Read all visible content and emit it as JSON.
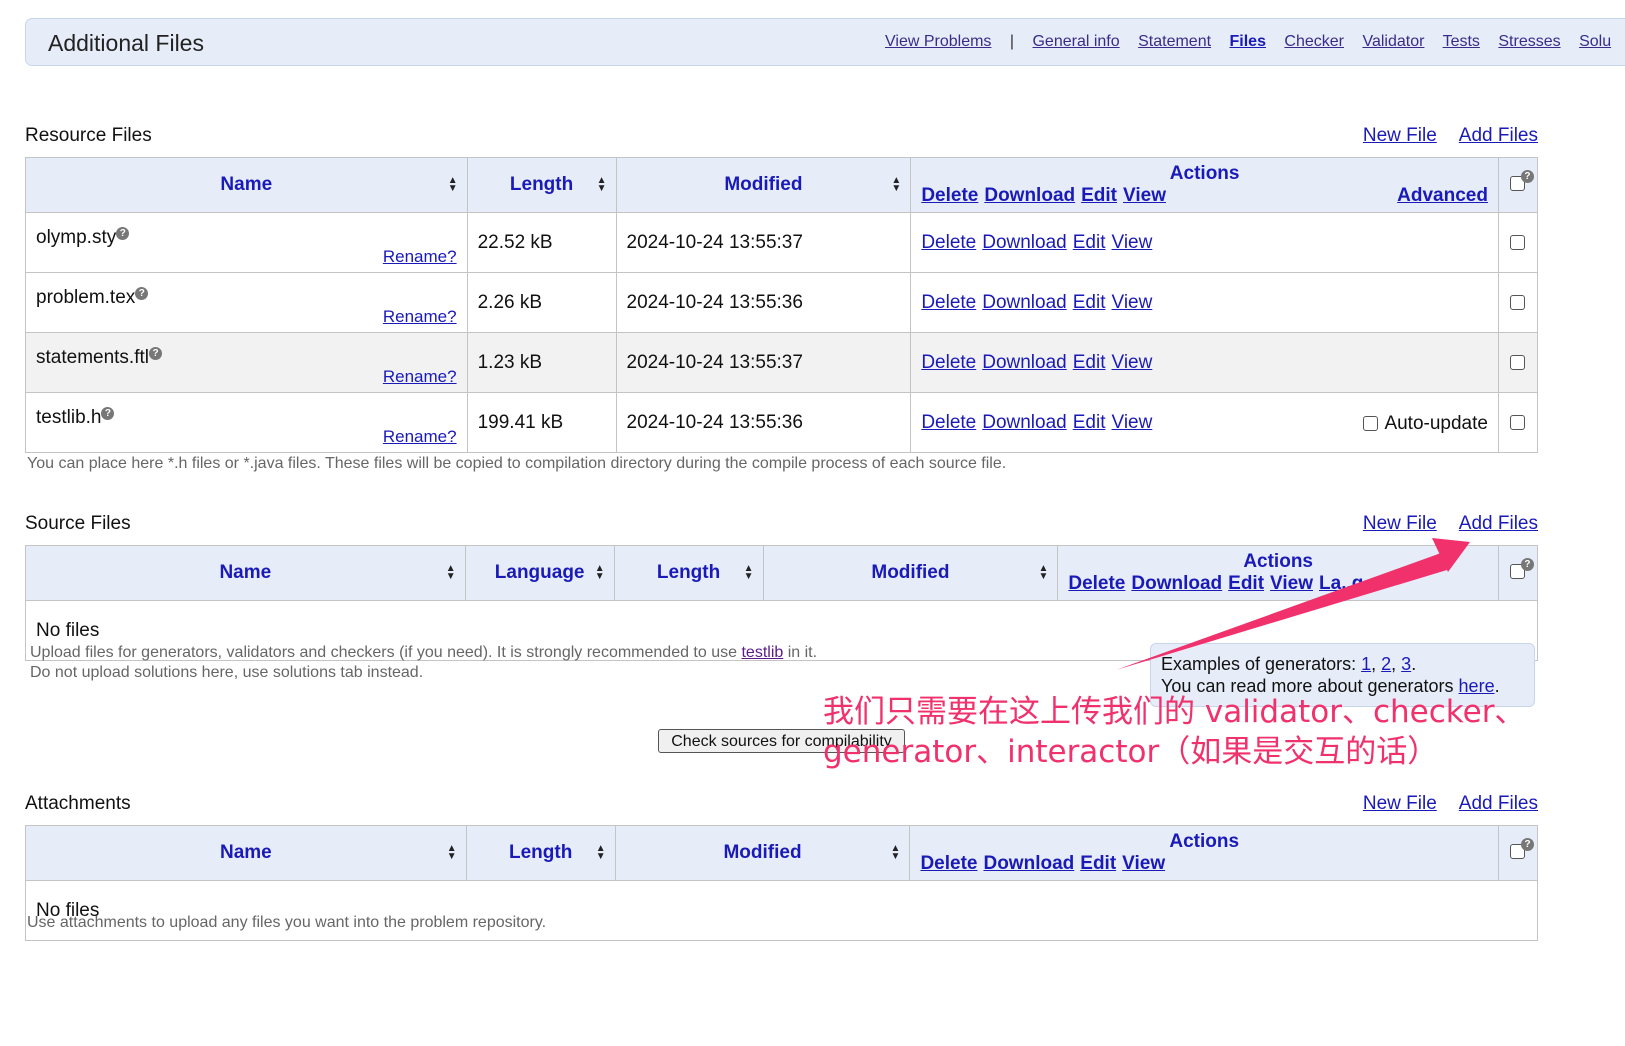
{
  "header": {
    "title": "Additional Files",
    "nav": [
      "View Problems",
      "|",
      "General info",
      "Statement",
      "Files",
      "Checker",
      "Validator",
      "Tests",
      "Stresses",
      "Solu"
    ]
  },
  "common": {
    "new_file": "New File",
    "add_files": "Add Files",
    "rename": "Rename?",
    "delete": "Delete",
    "download": "Download",
    "edit": "Edit",
    "view": "View",
    "no_files": "No files",
    "sort_glyph": "▲▼",
    "help_glyph": "?"
  },
  "resource": {
    "title": "Resource Files",
    "headers": {
      "name": "Name",
      "length": "Length",
      "modified": "Modified",
      "actions": "Actions",
      "advanced": "Advanced"
    },
    "rows": [
      {
        "name": "olymp.sty",
        "length": "22.52 kB",
        "modified": "2024-10-24 13:55:37"
      },
      {
        "name": "problem.tex",
        "length": "2.26 kB",
        "modified": "2024-10-24 13:55:36"
      },
      {
        "name": "statements.ftl",
        "length": "1.23 kB",
        "modified": "2024-10-24 13:55:37"
      },
      {
        "name": "testlib.h",
        "length": "199.41 kB",
        "modified": "2024-10-24 13:55:36",
        "auto_update": "Auto-update"
      }
    ],
    "note": "You can place here *.h files or *.java files. These files will be copied to compilation directory during the compile process of each source file."
  },
  "source": {
    "title": "Source Files",
    "headers": {
      "name": "Name",
      "language": "Language",
      "length": "Length",
      "modified": "Modified",
      "actions": "Actions",
      "actions_tail": "La..g"
    },
    "note_line1_a": "Upload files for generators, validators and checkers (if you need). It is strongly recommended to use ",
    "note_link": "testlib",
    "note_line1_b": " in it.",
    "note_line2": "Do not upload solutions here, use solutions tab instead.",
    "examples": {
      "prefix": "Examples of generators: ",
      "links": [
        "1",
        "2",
        "3"
      ],
      "line2_prefix": "You can read more about generators ",
      "line2_link": "here",
      "line2_suffix": "."
    },
    "check_button": "Check sources for compilability"
  },
  "annotation": {
    "line1": "我们只需要在这上传我们的 validator、checker、",
    "line2": "generator、interactor（如果是交互的话）",
    "color": "#f0316c"
  },
  "attachments": {
    "title": "Attachments",
    "headers": {
      "name": "Name",
      "length": "Length",
      "modified": "Modified",
      "actions": "Actions"
    },
    "note": "Use attachments to upload any files you want into the problem repository."
  }
}
